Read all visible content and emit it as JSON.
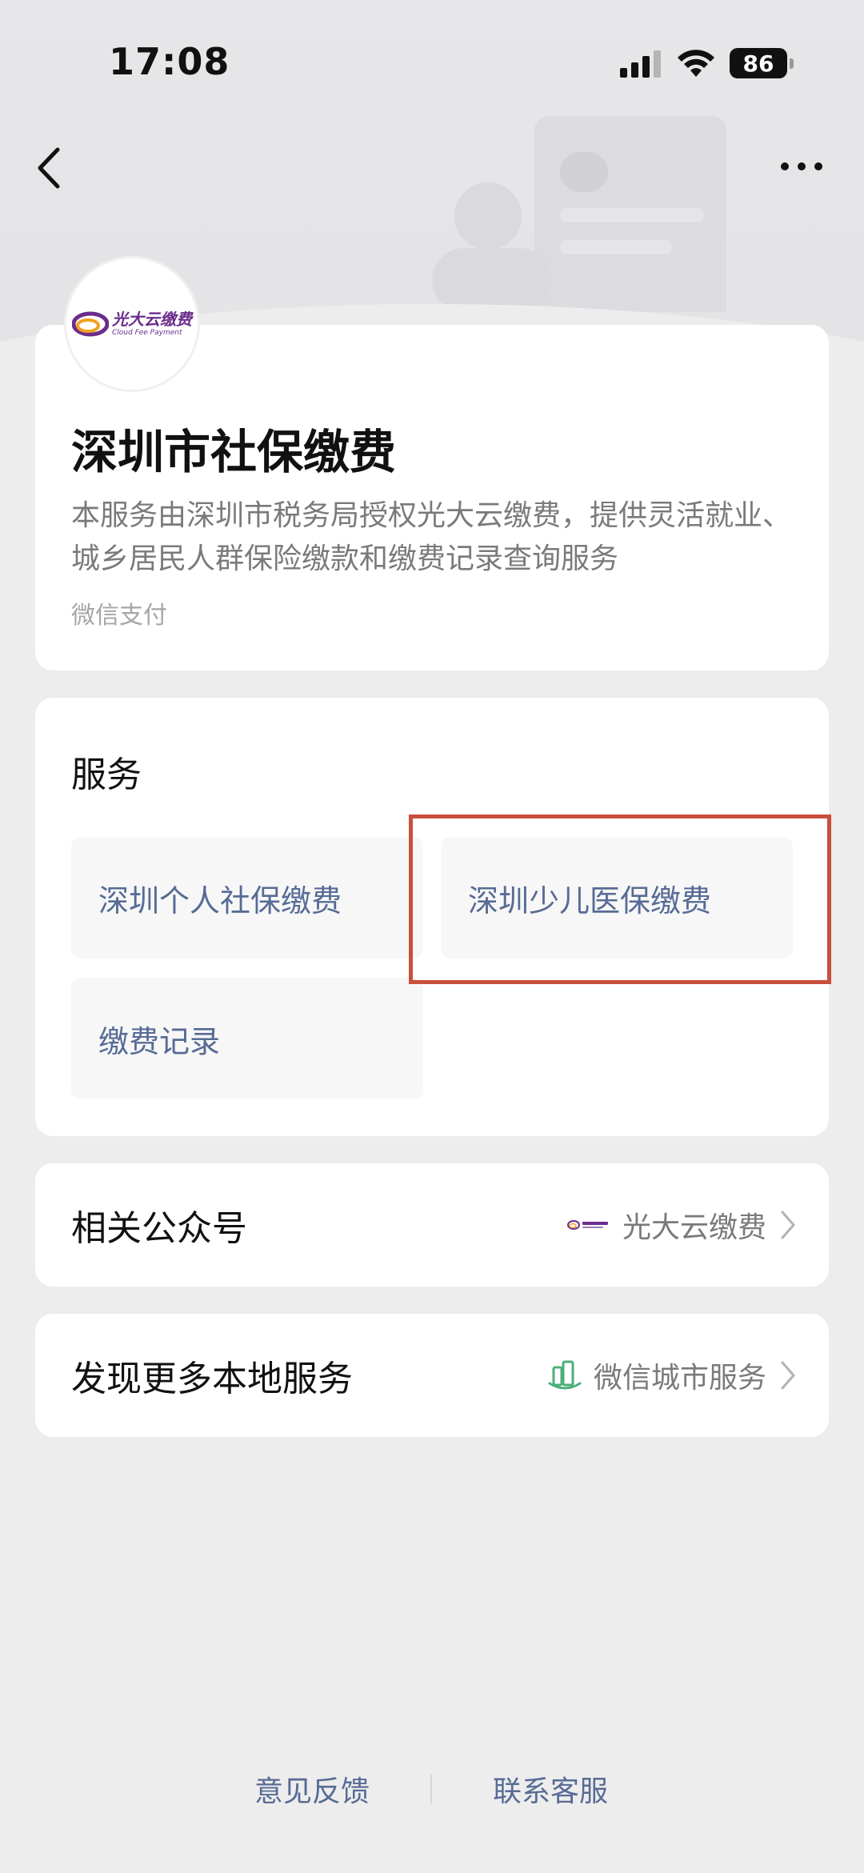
{
  "status_bar": {
    "time": "17:08",
    "battery": "86"
  },
  "app": {
    "title": "深圳市社保缴费",
    "description": "本服务由深圳市税务局授权光大云缴费，提供灵活就业、城乡居民人群保险缴款和缴费记录查询服务",
    "provider": "微信支付",
    "logo": {
      "name_cn": "光大云缴费",
      "name_en": "Cloud Fee Payment"
    }
  },
  "services": {
    "title": "服务",
    "items": [
      {
        "label": "深圳个人社保缴费"
      },
      {
        "label": "深圳少儿医保缴费"
      },
      {
        "label": "缴费记录"
      }
    ]
  },
  "related": {
    "label": "相关公众号",
    "value": "光大云缴费"
  },
  "discover": {
    "label": "发现更多本地服务",
    "value": "微信城市服务"
  },
  "footer": {
    "feedback": "意见反馈",
    "contact": "联系客服"
  },
  "colors": {
    "link": "#576b95",
    "highlight": "#c94f3d",
    "city_icon": "#4caf7a"
  }
}
